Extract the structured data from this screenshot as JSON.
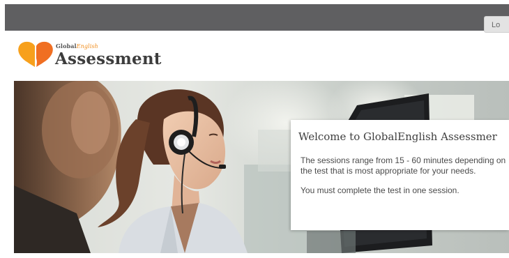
{
  "header": {
    "brand_small_prefix": "Global",
    "brand_small_italic": "English",
    "brand_title": "Assessment",
    "login_label": "Lo",
    "logo_icon": "heart-chat-logo",
    "logo_colors": [
      "#f7a01c",
      "#f06f22"
    ]
  },
  "hero": {
    "image_description_icon": "hero-photo"
  },
  "welcome": {
    "title": "Welcome to GlobalEnglish Assessmer",
    "line1": "The sessions range from 15 - 60 minutes depending on the test that is most appropriate for your needs.",
    "line2": "You must complete the test in one session."
  },
  "colors": {
    "top_bar": "#5f5f61",
    "brand_orange": "#f18e1e",
    "text_dark": "#3e3e3e"
  }
}
